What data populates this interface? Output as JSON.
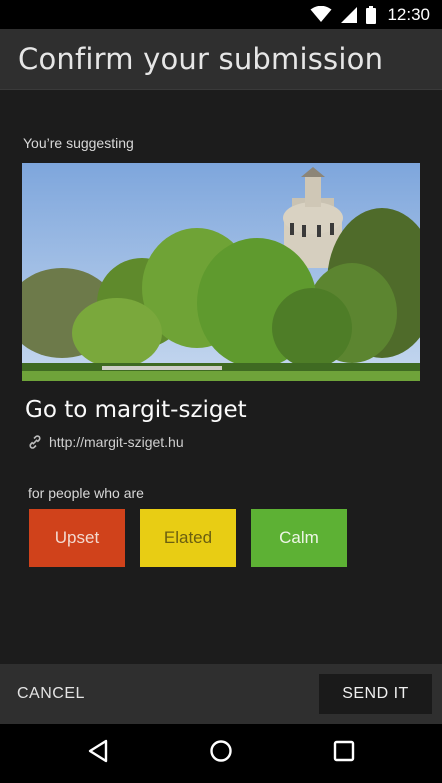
{
  "status_bar": {
    "time": "12:30",
    "icons": [
      "wifi-icon",
      "signal-icon",
      "battery-icon"
    ]
  },
  "app_bar": {
    "title": "Confirm your submission"
  },
  "content": {
    "suggesting_label": "You’re suggesting",
    "photo": "water-tower-park-photo",
    "suggestion_title": "Go to margit-sziget",
    "link": {
      "icon": "link-icon",
      "url": "http://margit-sziget.hu"
    },
    "people_label": "for people who are",
    "moods": [
      {
        "label": "Upset",
        "bg": "#d0421b",
        "fg": "#f3d9cf"
      },
      {
        "label": "Elated",
        "bg": "#e8cd14",
        "fg": "#6b5f10"
      },
      {
        "label": "Calm",
        "bg": "#5db134",
        "fg": "#eef6e6"
      }
    ]
  },
  "actions": {
    "cancel_label": "CANCEL",
    "send_label": "SEND IT"
  },
  "nav_bar": {
    "icons": [
      "back-icon",
      "home-icon",
      "recents-icon"
    ]
  }
}
